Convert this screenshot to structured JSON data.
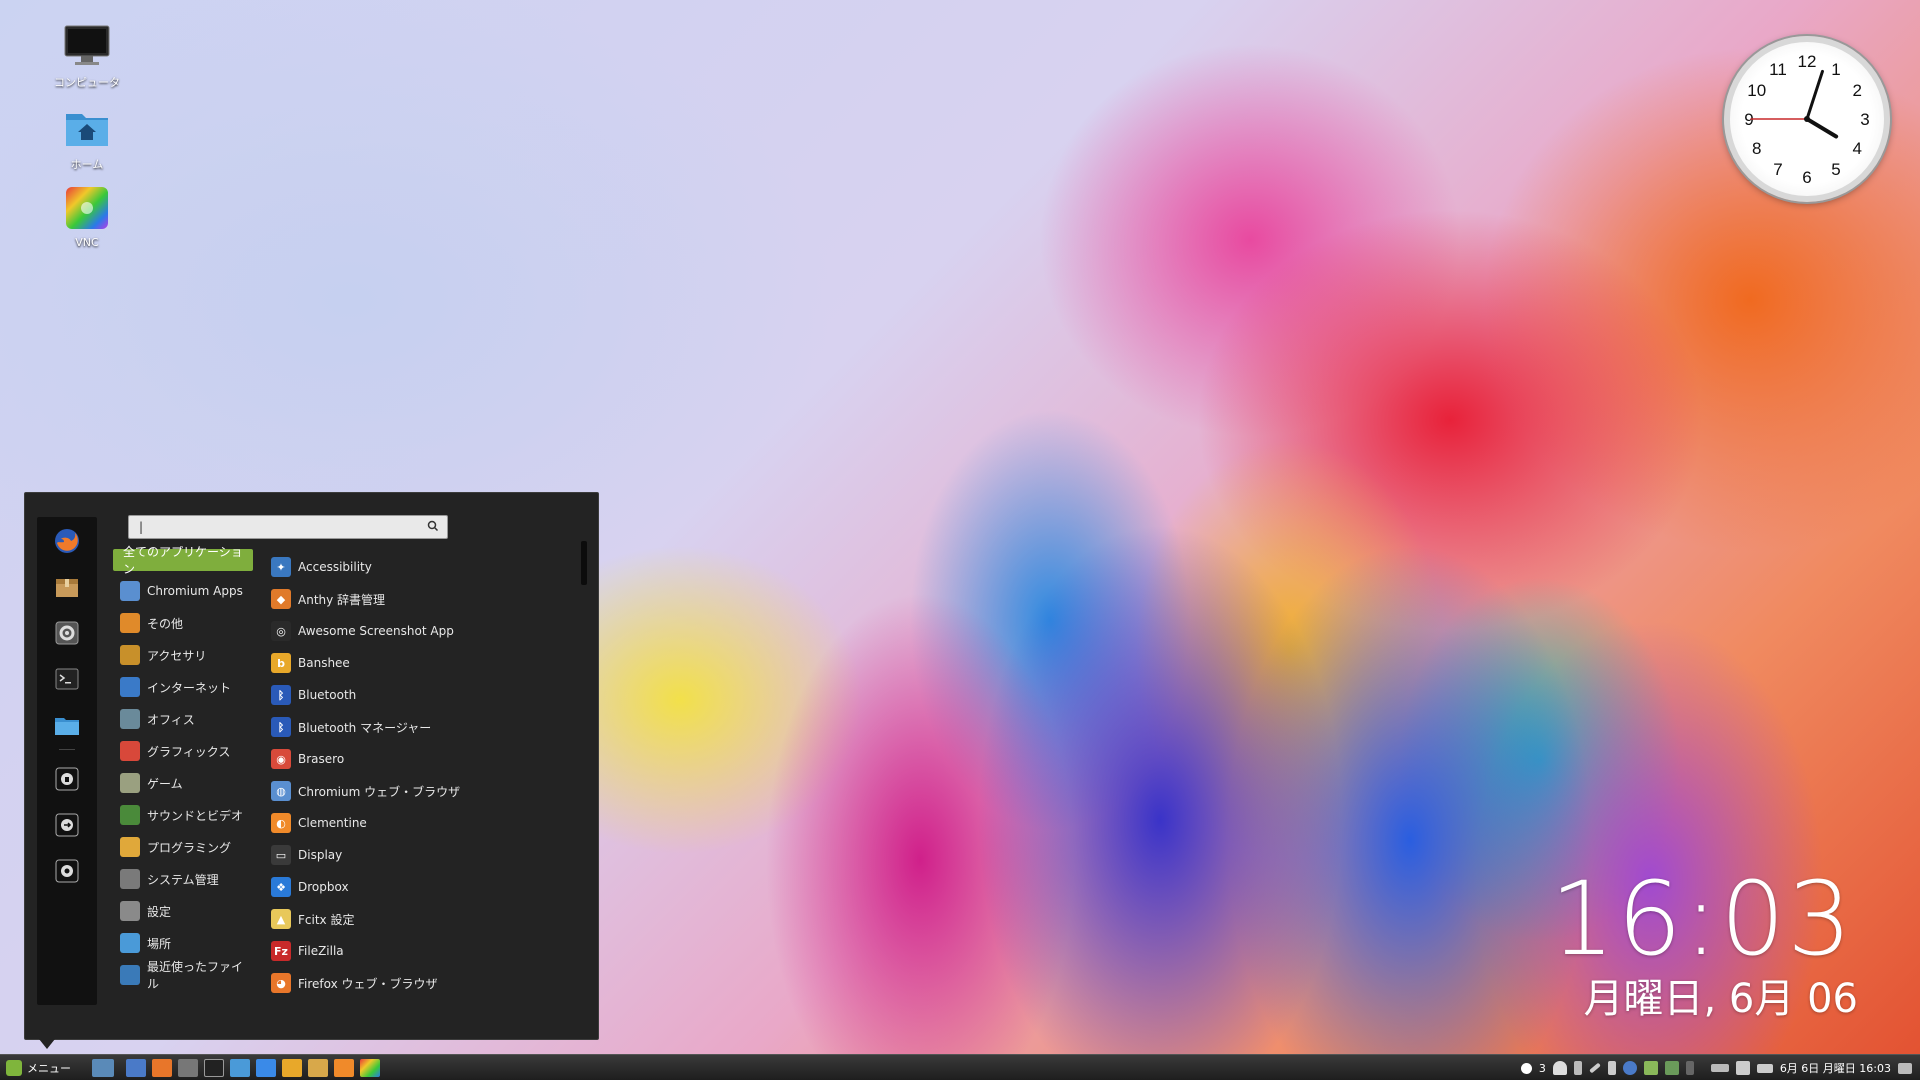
{
  "desktop": {
    "icons": [
      {
        "label": "コンピュータ"
      },
      {
        "label": "ホーム"
      },
      {
        "label": "VNC"
      }
    ]
  },
  "clock_widget": {
    "numbers": [
      "12",
      "1",
      "2",
      "3",
      "4",
      "5",
      "6",
      "7",
      "8",
      "9",
      "10",
      "11"
    ]
  },
  "desklet": {
    "time": "16:03",
    "date": "月曜日, 6月 06"
  },
  "menu": {
    "search": {
      "value": "|"
    },
    "favorites": [
      "firefox-icon",
      "package-icon",
      "settings-icon",
      "terminal-icon",
      "folder-icon",
      "lock-icon",
      "logout-icon",
      "power-icon"
    ],
    "categories": [
      {
        "label": "全てのアプリケーション",
        "color": "#7fae3d"
      },
      {
        "label": "Chromium Apps",
        "color": "#5a8fd0"
      },
      {
        "label": "その他",
        "color": "#e08a2a"
      },
      {
        "label": "アクセサリ",
        "color": "#c8902a"
      },
      {
        "label": "インターネット",
        "color": "#3a7ac8"
      },
      {
        "label": "オフィス",
        "color": "#6a8a9a"
      },
      {
        "label": "グラフィックス",
        "color": "#d8483a"
      },
      {
        "label": "ゲーム",
        "color": "#9aa080"
      },
      {
        "label": "サウンドとビデオ",
        "color": "#4a8a3a"
      },
      {
        "label": "プログラミング",
        "color": "#e0a83a"
      },
      {
        "label": "システム管理",
        "color": "#7a7a7a"
      },
      {
        "label": "設定",
        "color": "#8a8a8a"
      },
      {
        "label": "場所",
        "color": "#4a9ad8"
      },
      {
        "label": "最近使ったファイル",
        "color": "#3a7ab8"
      }
    ],
    "apps": [
      {
        "label": "Accessibility",
        "color": "#3a78c0",
        "glyph": "✦"
      },
      {
        "label": "Anthy 辞書管理",
        "color": "#e07a2a",
        "glyph": "◆"
      },
      {
        "label": "Awesome Screenshot App",
        "color": "#2a2a2a",
        "glyph": "◎"
      },
      {
        "label": "Banshee",
        "color": "#e8a82a",
        "glyph": "b"
      },
      {
        "label": "Bluetooth",
        "color": "#2a5ab8",
        "glyph": "ᛒ"
      },
      {
        "label": "Bluetooth マネージャー",
        "color": "#2a5ab8",
        "glyph": "ᛒ"
      },
      {
        "label": "Brasero",
        "color": "#d84a3a",
        "glyph": "◉"
      },
      {
        "label": "Chromium ウェブ・ブラウザ",
        "color": "#5a8fd0",
        "glyph": "◍"
      },
      {
        "label": "Clementine",
        "color": "#f08a2a",
        "glyph": "◐"
      },
      {
        "label": "Display",
        "color": "#3a3a3a",
        "glyph": "▭"
      },
      {
        "label": "Dropbox",
        "color": "#2a7ad8",
        "glyph": "❖"
      },
      {
        "label": "Fcitx 設定",
        "color": "#e8c85a",
        "glyph": "▲"
      },
      {
        "label": "FileZilla",
        "color": "#c82a2a",
        "glyph": "Fz"
      },
      {
        "label": "Firefox ウェブ・ブラウザ",
        "color": "#e8762a",
        "glyph": "◕"
      }
    ]
  },
  "taskbar": {
    "menu_label": "メニュー",
    "tray": {
      "notifications": "3",
      "datetime": "6月 6日 月曜日 16:03"
    }
  }
}
